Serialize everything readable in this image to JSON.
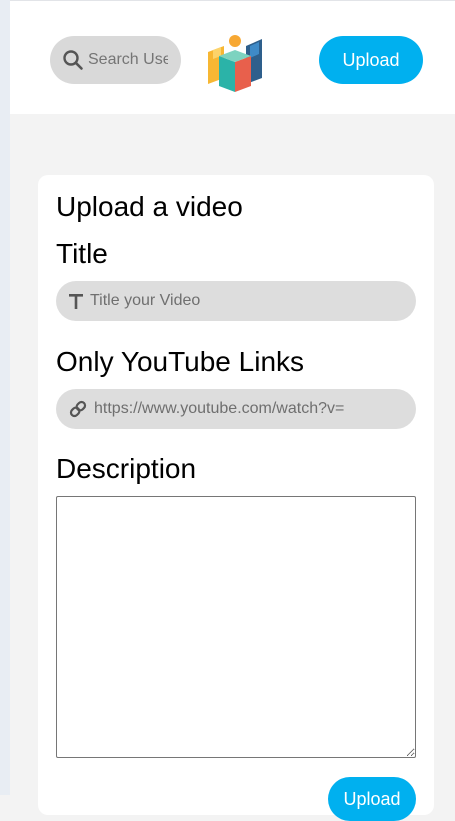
{
  "header": {
    "search": {
      "placeholder": "Search Users",
      "icon": "search-icon"
    },
    "logo": {
      "icon": "logo-icon",
      "colors": [
        "#f7b733",
        "#2bb3a8",
        "#e8604c",
        "#2e5f8c"
      ]
    },
    "upload_label": "Upload"
  },
  "form": {
    "title": "Upload a video",
    "title_field": {
      "label": "Title",
      "placeholder": "Title your Video",
      "icon": "text-icon"
    },
    "link_field": {
      "label": "Only YouTube Links",
      "placeholder": "https://www.youtube.com/watch?v=",
      "icon": "link-icon"
    },
    "description_field": {
      "label": "Description",
      "value": ""
    },
    "submit_label": "Upload"
  },
  "colors": {
    "accent": "#00b0ef",
    "page_background": "#f3f3f3",
    "field_background": "#dddddd"
  }
}
